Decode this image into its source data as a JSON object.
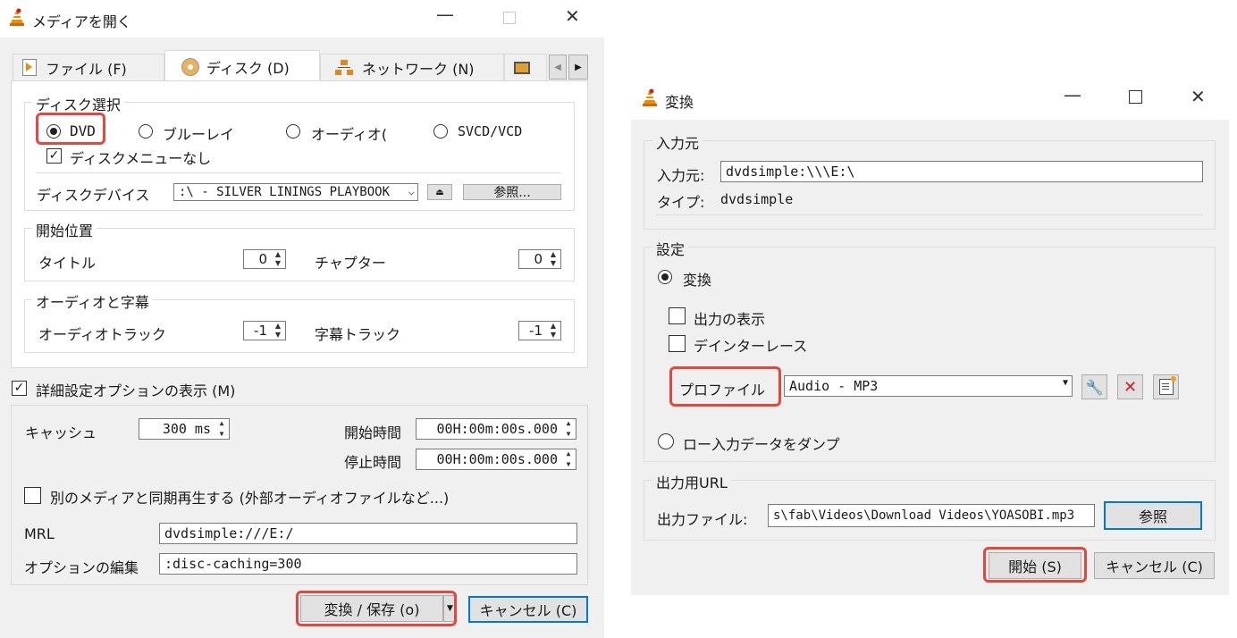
{
  "open_media": {
    "title": "メディアを開く",
    "tabs": [
      {
        "label": "ファイル (F)"
      },
      {
        "label": "ディスク (D)"
      },
      {
        "label": "ネットワーク (N)"
      }
    ],
    "disc_select": {
      "group_title": "ディスク選択",
      "options": [
        "DVD",
        "ブルーレイ",
        "オーディオ(",
        "SVCD/VCD"
      ],
      "selected": "DVD",
      "no_menu_label": "ディスクメニューなし",
      "no_menu_checked": true,
      "device_label": "ディスクデバイス",
      "device_value": ":\\ - SILVER LININGS PLAYBOOK",
      "browse_label": "参照..."
    },
    "start_position": {
      "group_title": "開始位置",
      "title_label": "タイトル",
      "title_value": "0",
      "chapter_label": "チャプター",
      "chapter_value": "0"
    },
    "audio_subs": {
      "group_title": "オーディオと字幕",
      "audio_track_label": "オーディオトラック",
      "audio_track_value": "-1",
      "subtitle_track_label": "字幕トラック",
      "subtitle_track_value": "-1"
    },
    "show_advanced_label": "詳細設定オプションの表示 (M)",
    "show_advanced_checked": true,
    "advanced": {
      "cache_label": "キャッシュ",
      "cache_value": "300 ms",
      "start_time_label": "開始時間",
      "start_time_value": "00H:00m:00s.000",
      "stop_time_label": "停止時間",
      "stop_time_value": "00H:00m:00s.000",
      "sync_label": "別のメディアと同期再生する (外部オーディオファイルなど...)",
      "sync_checked": false,
      "mrl_label": "MRL",
      "mrl_value": "dvdsimple:///E:/",
      "edit_options_label": "オプションの編集",
      "edit_options_value": ":disc-caching=300"
    },
    "convert_save_label": "変換 / 保存 (o)",
    "cancel_label": "キャンセル (C)"
  },
  "convert": {
    "title": "変換",
    "source": {
      "group_title": "入力元",
      "source_label": "入力元:",
      "source_value": "dvdsimple:\\\\\\E:\\",
      "type_label": "タイプ:",
      "type_value": "dvdsimple"
    },
    "settings": {
      "group_title": "設定",
      "convert_label": "変換",
      "convert_selected": true,
      "show_output_label": "出力の表示",
      "deinterlace_label": "デインターレース",
      "profile_label": "プロファイル",
      "profile_value": "Audio - MP3",
      "dump_raw_label": "ロー入力データをダンプ"
    },
    "destination": {
      "group_title": "出力用URL",
      "output_file_label": "出力ファイル:",
      "output_file_value": "s\\fab\\Videos\\Download Videos\\YOASOBI.mp3",
      "browse_label": "参照"
    },
    "start_label": "開始 (S)",
    "cancel_label": "キャンセル (C)"
  },
  "colors": {
    "highlight": "#e4473e",
    "window_bg": "#f0f0f0",
    "focus_blue": "#0078d7"
  }
}
